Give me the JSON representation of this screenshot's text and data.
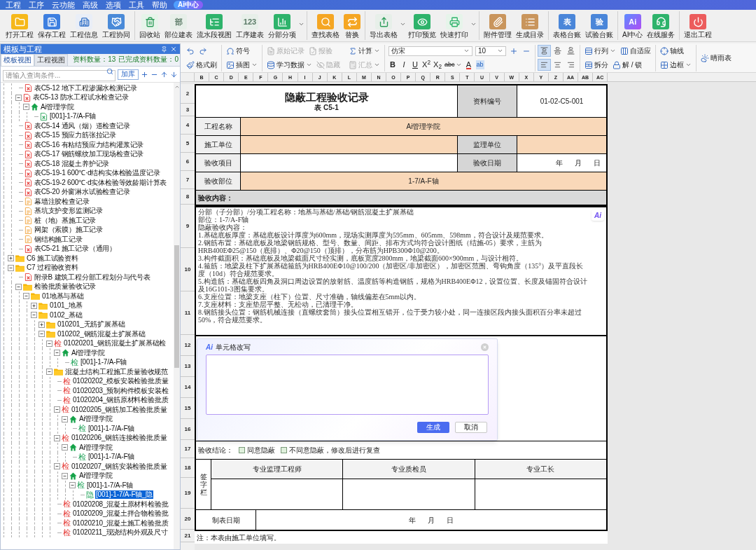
{
  "menu": [
    "工程",
    "工序",
    "云功能",
    "高级",
    "选项",
    "工具",
    "帮助"
  ],
  "ai_center": "Ai中心",
  "toolbar": [
    [
      {
        "label": "打开工程"
      },
      {
        "label": "保存工程"
      },
      {
        "label": "工程信息"
      },
      {
        "label": "工程协同"
      }
    ],
    [
      {
        "label": "回收站"
      },
      {
        "label": "部位建表",
        "icon_text": "部"
      },
      {
        "label": "流水段视图"
      },
      {
        "label": "工序建表",
        "icon_text": "123"
      },
      {
        "label": "分部分项",
        "menu": true
      }
    ],
    [
      {
        "label": "查找表格"
      },
      {
        "label": "替换"
      }
    ],
    [
      {
        "label": "导出表格",
        "menu": true
      },
      {
        "label": "打印预览"
      },
      {
        "label": "快速打印",
        "menu": true
      }
    ],
    [
      {
        "label": "附件管理"
      },
      {
        "label": "生成目录"
      }
    ],
    [
      {
        "label": "表格台账",
        "icon_text": "表"
      },
      {
        "label": "试验台账",
        "icon_text": "验"
      }
    ],
    [
      {
        "label": "AI中心",
        "icon_text": "Ai"
      },
      {
        "label": "在线服务"
      }
    ],
    [
      {
        "label": "退出工程"
      }
    ]
  ],
  "panel": {
    "title": "模板与工程",
    "tabs": [
      {
        "label": "模板视图",
        "selected": true
      },
      {
        "label": "工程视图",
        "selected": false
      }
    ],
    "count": "资料数量：13",
    "done_count": "已完成资料数量：0",
    "search_placeholder": "请输入查询条件...",
    "add_button": "加库"
  },
  "tree": {
    "continued_items": [
      {
        "kind": "sheet",
        "label": "表C5-12 地下工程渗漏水检测记录",
        "completed": false,
        "selected": false
      },
      {
        "kind": "sheet",
        "label": "表C5-13 防水工程试水检查记录",
        "completed": false,
        "selected": false,
        "expanded": true,
        "children": [
          {
            "kind": "unit",
            "label": "Ai管理学院",
            "selected": false,
            "expanded": true,
            "children": [
              {
                "kind": "sheet",
                "label": "[001]-1-7/A-F轴",
                "completed": true,
                "selected": false
              }
            ]
          }
        ]
      },
      {
        "kind": "sheet",
        "label": "表C5-14 通风（烟）道检查记录",
        "completed": false,
        "selected": false
      },
      {
        "kind": "sheet",
        "label": "表C5-15 预应力筋张拉记录",
        "completed": false,
        "selected": false
      },
      {
        "kind": "sheet",
        "label": "表C5-16 有粘结预应力结构灌浆记录",
        "completed": false,
        "selected": false
      },
      {
        "kind": "sheet",
        "label": "表C5-17 钢筋螺纹加工现场检查记录",
        "completed": false,
        "selected": false
      },
      {
        "kind": "sheet",
        "label": "表C5-18 混凝土养护记录",
        "completed": false,
        "selected": false
      },
      {
        "kind": "sheet",
        "label": "表C5-19-1 600℃·d结构实体检验温度记录",
        "completed": false,
        "selected": false
      },
      {
        "kind": "sheet",
        "label": "表C5-19-2 600℃·d实体检验等效龄期计算表",
        "completed": false,
        "selected": false
      },
      {
        "kind": "sheet",
        "label": "表C5-20 外窗淋水试验检查记录",
        "completed": false,
        "selected": false
      },
      {
        "kind": "form",
        "label": "幕墙注胶检查记录",
        "selected": false
      },
      {
        "kind": "form",
        "label": "基坑支护变形监测记录",
        "selected": false
      },
      {
        "kind": "form",
        "label": "桩（地）基施工记录",
        "selected": false
      },
      {
        "kind": "form",
        "label": "网架（索膜）施工记录",
        "selected": false
      },
      {
        "kind": "form",
        "label": "钢结构施工记录",
        "selected": false
      },
      {
        "kind": "sheet",
        "label": "表C5-21 施工记录（通用）",
        "completed": false,
        "selected": false
      }
    ],
    "items": [
      {
        "kind": "folder",
        "label": "C6 施工试验资料",
        "selected": false,
        "expanded": false
      },
      {
        "kind": "folder",
        "label": "C7 过程验收资料",
        "selected": false,
        "expanded": true,
        "children": [
          {
            "kind": "sheet",
            "label": "附录B 建筑工程分部工程划分与代号表",
            "completed": false,
            "selected": false
          },
          {
            "kind": "folder",
            "label": "检验批质量验收记录",
            "selected": false,
            "expanded": true,
            "children": [
              {
                "kind": "folder",
                "label": "01地基与基础",
                "selected": false,
                "expanded": true,
                "children": [
                  {
                    "kind": "folder",
                    "label": "0101_地基",
                    "selected": false,
                    "expanded": false
                  },
                  {
                    "kind": "folder",
                    "label": "0102_基础",
                    "selected": false,
                    "expanded": true,
                    "children": [
                      {
                        "kind": "folder",
                        "label": "010201_无筋扩展基础",
                        "selected": false,
                        "expanded": false
                      },
                      {
                        "kind": "folder",
                        "label": "010202_钢筋混凝土扩展基础",
                        "selected": false,
                        "expanded": true,
                        "children": [
                          {
                            "kind": "glyph",
                            "glyph": "检",
                            "label": "01020201_钢筋混凝土扩展基础检",
                            "completed": false,
                            "selected": false,
                            "expanded": true,
                            "children": [
                              {
                                "kind": "unit",
                                "label": "Ai管理学院",
                                "selected": false,
                                "expanded": true,
                                "children": [
                                  {
                                    "kind": "glyph",
                                    "glyph": "检",
                                    "label": "[001]-1-7/A-F轴",
                                    "completed": true,
                                    "selected": false
                                  }
                                ]
                              }
                            ]
                          },
                          {
                            "kind": "folder",
                            "label": "混凝土结构工程施工质量验收规范",
                            "selected": false,
                            "expanded": true,
                            "children": [
                              {
                                "kind": "glyph",
                                "glyph": "检",
                                "label": "01020202_模板安装检验批质量",
                                "completed": false,
                                "selected": false
                              },
                              {
                                "kind": "glyph",
                                "glyph": "检",
                                "label": "01020203_预制构件模板安装检",
                                "completed": false,
                                "selected": false
                              },
                              {
                                "kind": "glyph",
                                "glyph": "检",
                                "label": "01020204_钢筋原材料检验批质",
                                "completed": false,
                                "selected": false
                              },
                              {
                                "kind": "glyph",
                                "glyph": "检",
                                "label": "01020205_钢筋加工检验批质量",
                                "completed": false,
                                "selected": false,
                                "expanded": true,
                                "children": [
                                  {
                                    "kind": "unit",
                                    "label": "Ai管理学院",
                                    "selected": false,
                                    "expanded": true,
                                    "children": [
                                      {
                                        "kind": "glyph",
                                        "glyph": "检",
                                        "label": "[001]-1-7/A-F轴",
                                        "completed": true,
                                        "selected": false
                                      }
                                    ]
                                  }
                                ]
                              },
                              {
                                "kind": "glyph",
                                "glyph": "检",
                                "label": "01020206_钢筋连接检验批质量",
                                "completed": false,
                                "selected": false,
                                "expanded": true,
                                "children": [
                                  {
                                    "kind": "unit",
                                    "label": "Ai管理学院",
                                    "selected": false,
                                    "expanded": true,
                                    "children": [
                                      {
                                        "kind": "glyph",
                                        "glyph": "检",
                                        "label": "[001]-1-7/A-F轴",
                                        "completed": true,
                                        "selected": false
                                      }
                                    ]
                                  }
                                ]
                              },
                              {
                                "kind": "glyph",
                                "glyph": "检",
                                "label": "01020207_钢筋安装检验批质量",
                                "completed": false,
                                "selected": false,
                                "expanded": true,
                                "children": [
                                  {
                                    "kind": "unit",
                                    "label": "Ai管理学院",
                                    "selected": false,
                                    "expanded": true,
                                    "children": [
                                      {
                                        "kind": "glyph",
                                        "glyph": "检",
                                        "label": "[001]-1-7/A-F轴",
                                        "completed": true,
                                        "selected": false,
                                        "expanded": true,
                                        "children": [
                                          {
                                            "kind": "glyph",
                                            "glyph": "隐",
                                            "label": "[001]-1-7/A-F轴_隐",
                                            "completed": true,
                                            "selected": true
                                          }
                                        ]
                                      }
                                    ]
                                  }
                                ]
                              },
                              {
                                "kind": "glyph",
                                "glyph": "检",
                                "label": "01020208_混凝土原材料检验批",
                                "completed": false,
                                "selected": false
                              },
                              {
                                "kind": "glyph",
                                "glyph": "检",
                                "label": "01020209_混凝土拌合物检验批",
                                "completed": false,
                                "selected": false
                              },
                              {
                                "kind": "glyph",
                                "glyph": "检",
                                "label": "01020210_混凝土施工检验批质",
                                "completed": false,
                                "selected": false
                              },
                              {
                                "kind": "glyph",
                                "glyph": "检",
                                "label": "01020211_现浇结构外观及尺寸",
                                "completed": false,
                                "selected": false
                              }
                            ]
                          }
                        ]
                      }
                    ]
                  }
                ]
              }
            ]
          }
        ]
      }
    ]
  },
  "ribbon": [
    {
      "divider_after": true,
      "top": [
        {
          "kind": "icon"
        },
        {
          "kind": "icon"
        }
      ],
      "bottom": [
        {
          "kind": "button",
          "label": "格式刷"
        }
      ]
    },
    {
      "divider_after": true,
      "top": [
        {
          "kind": "button",
          "label": "符号"
        }
      ],
      "bottom": [
        {
          "kind": "button",
          "label": "插图",
          "menu": true
        }
      ]
    },
    {
      "divider_after": false,
      "top": [
        {
          "kind": "button",
          "label": "原始记录",
          "disabled": true
        },
        {
          "kind": "button",
          "label": "报验",
          "disabled": true
        }
      ],
      "bottom": [
        {
          "kind": "button",
          "label": "学习数据",
          "menu": true,
          "disabled": false
        },
        {
          "kind": "button",
          "label": "隐藏",
          "disabled": true
        }
      ]
    },
    {
      "divider_after": true,
      "top": [
        {
          "kind": "button",
          "label": "计算",
          "menu": true,
          "disabled": false
        }
      ],
      "bottom": [
        {
          "kind": "button",
          "label": "汇总",
          "menu": true,
          "disabled": true
        }
      ]
    },
    {
      "divider_after": true,
      "top": [
        {
          "kind": "select",
          "value": "仿宋"
        },
        {
          "kind": "select",
          "value": "10"
        },
        {
          "kind": "icon"
        },
        {
          "kind": "icon"
        }
      ],
      "bottom": [
        {
          "kind": "glyph",
          "text": "B"
        },
        {
          "kind": "glyph",
          "text": "I"
        },
        {
          "kind": "glyph",
          "text": "U"
        },
        {
          "kind": "glyph",
          "text": "X$^{2}$"
        },
        {
          "kind": "glyph",
          "text": "X$_{2}$"
        },
        {
          "kind": "glyph",
          "text": "abc",
          "menu": true
        },
        {
          "kind": "glyph",
          "text": "A"
        },
        {
          "kind": "glyph",
          "text": "ab"
        }
      ]
    },
    {
      "divider_after": true,
      "top": [
        {
          "kind": "align",
          "selected": true
        },
        {
          "kind": "align",
          "selected": false
        },
        {
          "kind": "align",
          "selected": false
        }
      ],
      "bottom": [
        {
          "kind": "align",
          "selected": true
        },
        {
          "kind": "align",
          "selected": false
        },
        {
          "kind": "align",
          "selected": false
        }
      ]
    },
    {
      "divider_after": true,
      "top": [
        {
          "kind": "button",
          "label": "行列",
          "menu": true
        },
        {
          "kind": "button",
          "label": "自适应"
        }
      ],
      "bottom": [
        {
          "kind": "button",
          "label": "拆分"
        },
        {
          "kind": "button",
          "label": "解 / 锁"
        }
      ]
    },
    {
      "divider_after": true,
      "top": [
        {
          "kind": "button",
          "label": "轴线"
        }
      ],
      "bottom": [
        {
          "kind": "button",
          "label": "边框",
          "menu": true
        }
      ]
    },
    {
      "divider_after": false,
      "top": [
        {
          "kind": "button",
          "label": "晴雨表"
        }
      ]
    }
  ],
  "sheet": {
    "column_headers": [
      "B",
      "C",
      "D",
      "E",
      "F",
      "G",
      "H",
      "I",
      "J",
      "K",
      "L",
      "M",
      "N",
      "O",
      "P",
      "Q",
      "R",
      "S",
      "T",
      "U",
      "V",
      "W",
      "X",
      "Y",
      "Z",
      "AA",
      "AB",
      "AC"
    ],
    "row_numbers": [
      "2",
      "3",
      "4",
      "5",
      "6",
      "7",
      "8",
      "9",
      "10",
      "11",
      "12",
      "13",
      "14",
      "15",
      "16",
      "17",
      "18",
      "19",
      "20",
      "21"
    ]
  },
  "document": {
    "title": "隐蔽工程验收记录",
    "form_no": "表 C5-1",
    "record_no_label": "资料编号",
    "record_no": "01-02-C5-001",
    "project_name": {
      "label": "工程名称",
      "value": "Ai管理学院"
    },
    "builder": {
      "label": "施工单位"
    },
    "supervisor": {
      "label": "监理单位"
    },
    "inspection_item": {
      "label": "验收项目"
    },
    "inspection_date": {
      "label": "验收日期",
      "value": "年 月 日"
    },
    "location": {
      "label": "验收部位",
      "value": "1-7/A-F轴"
    },
    "content_label": "验收内容：",
    "ai_badge": "Ai",
    "content_lines": [
      "分部（子分部）/分项工程名称：地基与基础/基础/钢筋混凝土扩展基础",
      "部位：1-7/A-F轴",
      "隐蔽验收内容：",
      "1.基础底板厚度：基础底板设计厚度为600mm，现场实测厚度为595mm、605mm、598mm，符合设计及规范要求。",
      "2.钢筋布置：基础底板及地梁钢筋规格、型号、数量、间距、排布方式均符合设计图纸（结施-05）要求，主筋为HRB400EΦ25@150（底排）、Φ20@150（顶排），分布筋为HPB300Φ10@200。",
      "3.构件截面积：基础底板及地梁截面尺寸经实测，底板宽度2800mm，地梁截面600×900mm，与设计相符。",
      "4.箍筋：地梁及柱下扩展基础箍筋为HRB400EΦ10@100/200（加密区/非加密区），加密区范围、弯钩角度（135°）及平直段长度（10d）符合规范要求。",
      "5.构造筋：基础底板四角及洞口周边设置的放射筋、温度筋等构造钢筋，规格为HRB400EΦ12，设置位置、长度及锚固符合设计及16G101-3图集要求。",
      "6.支座位置：地梁支座（柱下）位置、尺寸准确，轴线偏差在5mm以内。",
      "7.支座材料：支座垫层平整、无松动，已清理干净。",
      "8.钢筋接头位置：钢筋机械连接（直螺纹套筒）接头位置相互错开，位于受力较小处，同一连接区段内接头面积百分率未超过50%，符合规范要求。"
    ],
    "conclusion": {
      "label": "验收结论：",
      "options": [
        {
          "label": "同意隐蔽",
          "checked": false
        },
        {
          "label": "不同意隐蔽，修改后进行复查",
          "checked": false
        }
      ]
    },
    "signature": {
      "label": "签字栏",
      "roles": [
        "专业监理工程师",
        "专业质检员",
        "专业工长"
      ]
    },
    "date_row": {
      "label": "制表日期",
      "value": "年 月 日"
    },
    "note": "注：本表由施工单位填写。"
  },
  "dialog": {
    "logo": "Ai",
    "title": "单元格改写",
    "confirm": "生成",
    "cancel": "取消"
  }
}
